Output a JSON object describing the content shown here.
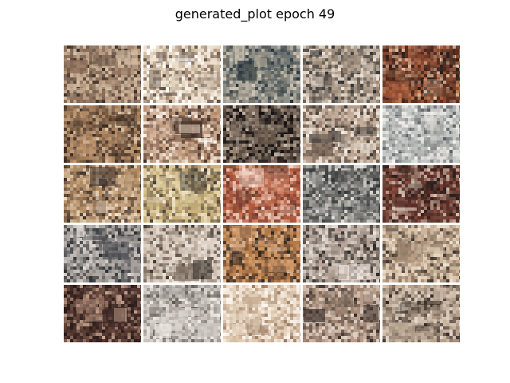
{
  "figure": {
    "title": "generated_plot epoch 49"
  },
  "grid": {
    "rows": 5,
    "cols": 5,
    "tiles": [
      {
        "id": "r1c1",
        "palette": [
          "#b79a82",
          "#8a6b55",
          "#d9c2a5",
          "#3b2f2a",
          "#6f5a4a",
          "#c8b39a"
        ]
      },
      {
        "id": "r1c2",
        "palette": [
          "#e6d6c1",
          "#ffffff",
          "#9b8572",
          "#5b4a40",
          "#c0aa8f",
          "#f2e5d6"
        ]
      },
      {
        "id": "r1c3",
        "palette": [
          "#8e8f88",
          "#3f4b4f",
          "#b2a899",
          "#24323b",
          "#6c6a5f",
          "#d3c8b7"
        ]
      },
      {
        "id": "r1c4",
        "palette": [
          "#9d8b79",
          "#e3d6c8",
          "#5b5550",
          "#b7a593",
          "#2f3236",
          "#f0e6dc"
        ]
      },
      {
        "id": "r1c5",
        "palette": [
          "#5a2f22",
          "#a85a3a",
          "#e0c3a5",
          "#2a1f1c",
          "#c97c52",
          "#7a4a34"
        ]
      },
      {
        "id": "r2c1",
        "palette": [
          "#8a6a4f",
          "#3b2a22",
          "#b58d66",
          "#e0c9ad",
          "#5a4637",
          "#c39a72"
        ]
      },
      {
        "id": "r2c2",
        "palette": [
          "#c7a58c",
          "#fbf6ef",
          "#6e4e3c",
          "#e3cdb5",
          "#3a2a24",
          "#b58a69"
        ]
      },
      {
        "id": "r2c3",
        "palette": [
          "#2c2623",
          "#6c5a4d",
          "#b09985",
          "#15110f",
          "#8b7968",
          "#d2c2b2"
        ]
      },
      {
        "id": "r2c4",
        "palette": [
          "#b59d8a",
          "#e7dccf",
          "#6d5a4c",
          "#c6b2a0",
          "#3f3a37",
          "#f4ede6"
        ]
      },
      {
        "id": "r2c5",
        "palette": [
          "#c5c7c6",
          "#8d8d8b",
          "#e6e4df",
          "#5c5f63",
          "#aeb0ae",
          "#f3f1ed"
        ]
      },
      {
        "id": "r3c1",
        "palette": [
          "#b08a62",
          "#e3cfb4",
          "#6d5647",
          "#c6a785",
          "#3e342e",
          "#f2e4d4"
        ]
      },
      {
        "id": "r3c2",
        "palette": [
          "#c9b27d",
          "#e7d7ab",
          "#7e6a53",
          "#a58a62",
          "#3f3a35",
          "#f1e8d5"
        ]
      },
      {
        "id": "r3c3",
        "palette": [
          "#b45a3e",
          "#e4b79f",
          "#6a3c31",
          "#f3e0d5",
          "#8d4e3b",
          "#d1876b"
        ]
      },
      {
        "id": "r3c4",
        "palette": [
          "#6a6a67",
          "#c9c7c1",
          "#2f3334",
          "#9c9a95",
          "#e3e0da",
          "#50524f"
        ]
      },
      {
        "id": "r3c5",
        "palette": [
          "#5a2f28",
          "#8d4e40",
          "#bfa494",
          "#2b1f1c",
          "#6f4b3f",
          "#d6c2b4"
        ]
      },
      {
        "id": "r4c1",
        "palette": [
          "#8f8a87",
          "#c7c1bd",
          "#4d4f52",
          "#b0a8a1",
          "#2c2f32",
          "#e1dbd6"
        ]
      },
      {
        "id": "r4c2",
        "palette": [
          "#cdbfb0",
          "#f0e9e1",
          "#7e6e61",
          "#a89686",
          "#3d3630",
          "#e1d4c7"
        ]
      },
      {
        "id": "r4c3",
        "palette": [
          "#b67a46",
          "#4a3a33",
          "#e4c3a2",
          "#2c2522",
          "#8b6144",
          "#d39a69"
        ]
      },
      {
        "id": "r4c4",
        "palette": [
          "#a4968b",
          "#d6cbc2",
          "#5c524c",
          "#bba89a",
          "#2f2a27",
          "#eee6df"
        ]
      },
      {
        "id": "r4c5",
        "palette": [
          "#cbb59c",
          "#f0e4d5",
          "#7f6a58",
          "#a58b72",
          "#3d3530",
          "#e6d2bd"
        ]
      },
      {
        "id": "r5c1",
        "palette": [
          "#3e2a26",
          "#6c4a3f",
          "#2a1c19",
          "#a2806d",
          "#5b3c33",
          "#caa792"
        ]
      },
      {
        "id": "r5c2",
        "palette": [
          "#c9c3bd",
          "#efebe7",
          "#8b8580",
          "#aca49d",
          "#5d5751",
          "#dcd6d0"
        ]
      },
      {
        "id": "r5c3",
        "palette": [
          "#e5d3bf",
          "#f7efe6",
          "#c2a58a",
          "#9c7d64",
          "#d8c2aa",
          "#fbf7f2"
        ]
      },
      {
        "id": "r5c4",
        "palette": [
          "#b69c8a",
          "#e5d8cb",
          "#6c5a4f",
          "#9a7f6c",
          "#3a2f2b",
          "#d7c3b4"
        ]
      },
      {
        "id": "r5c5",
        "palette": [
          "#b4a28f",
          "#e5d8cb",
          "#5f5147",
          "#8f7b69",
          "#2f2723",
          "#d5c1ad"
        ]
      }
    ]
  }
}
